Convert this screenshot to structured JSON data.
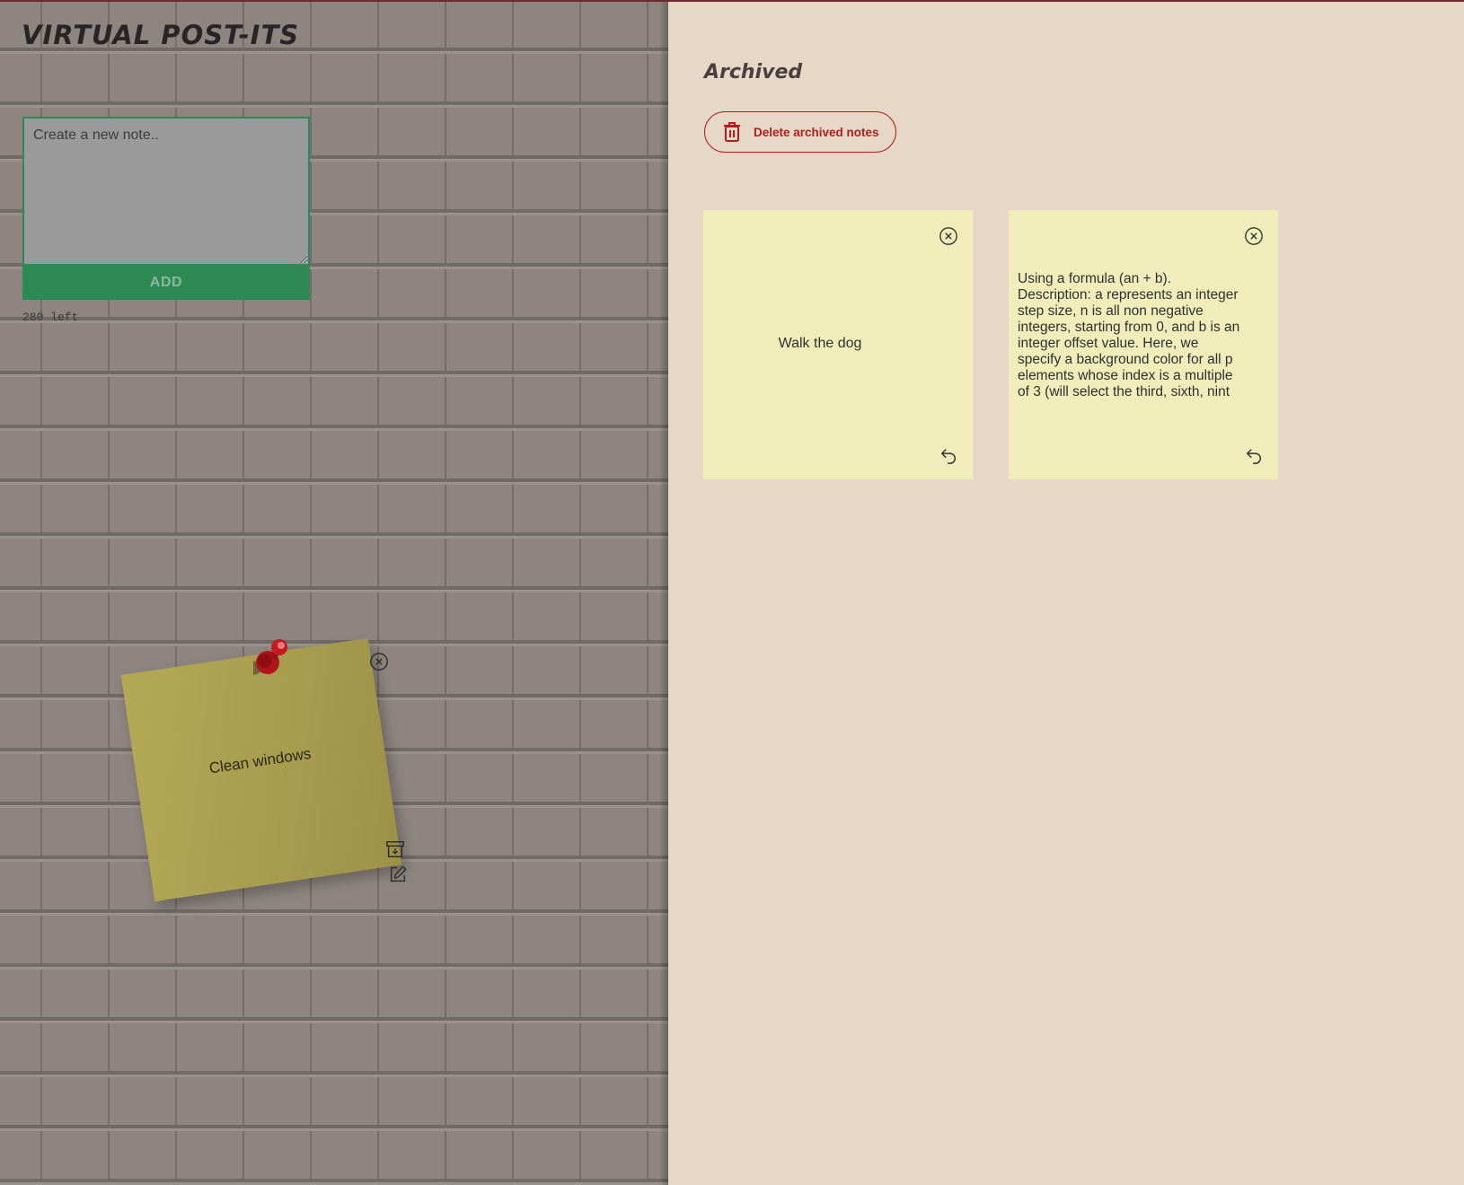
{
  "app": {
    "title": "VIRTUAL POST-ITS"
  },
  "composer": {
    "placeholder": "Create a new note..",
    "add_label": "ADD",
    "counter": "280 left"
  },
  "board": {
    "notes": [
      {
        "text": "Clean windows",
        "icons": [
          "close-icon",
          "archive-icon",
          "edit-icon",
          "pushpin-icon"
        ]
      }
    ]
  },
  "archive": {
    "title": "Archived",
    "delete_label": "Delete archived notes",
    "notes": [
      {
        "text": "Walk the dog"
      },
      {
        "text": "Using a formula (an + b). Description: a represents an integer step size, n is all non negative integers, starting from 0, and b is an integer offset value. Here, we specify a background color for all p elements whose index is a multiple of 3 (will select the third, sixth, nint"
      }
    ]
  },
  "colors": {
    "accent_green": "#2e8a54",
    "danger_red": "#b01e1e",
    "note_yellow": "#f0edbb",
    "panel_bg": "#e7d7c7"
  }
}
